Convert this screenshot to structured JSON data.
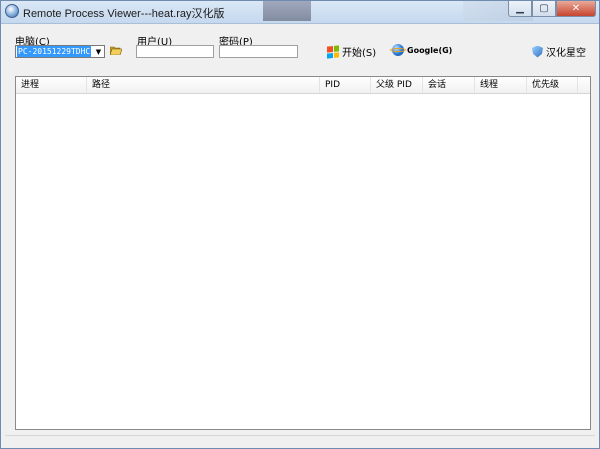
{
  "window": {
    "title": "Remote Process Viewer---heat.ray汉化版"
  },
  "form": {
    "computer_label": "电脑(C)",
    "computer_value": "PC-20151229TDHC",
    "user_label": "用户(U)",
    "user_value": "",
    "password_label": "密码(P)",
    "password_value": ""
  },
  "toolbar": {
    "start_label": "开始(S)",
    "google_label": "Google(G)",
    "credits_label": "汉化星空"
  },
  "table": {
    "columns": [
      "进程",
      "路径",
      "PID",
      "父级 PID",
      "会话",
      "线程",
      "优先级"
    ],
    "rows": []
  },
  "colors": {
    "selection": "#3399ff",
    "titlebar": "#c5d8ee",
    "close_button": "#c7442e"
  }
}
